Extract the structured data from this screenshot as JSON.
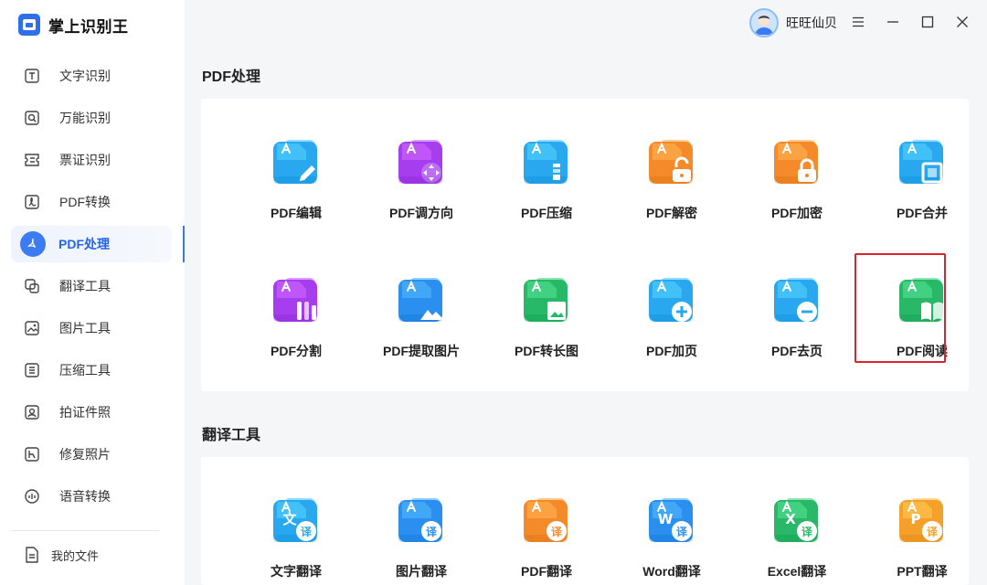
{
  "app": {
    "title": "掌上识别王"
  },
  "user": {
    "name": "旺旺仙贝"
  },
  "sidebar": {
    "items": [
      {
        "label": "文字识别",
        "icon": "text-recognition-icon"
      },
      {
        "label": "万能识别",
        "icon": "universal-recognition-icon"
      },
      {
        "label": "票证识别",
        "icon": "ticket-recognition-icon"
      },
      {
        "label": "PDF转换",
        "icon": "pdf-convert-icon"
      },
      {
        "label": "PDF处理",
        "icon": "pdf-process-icon",
        "active": true
      },
      {
        "label": "翻译工具",
        "icon": "translate-tool-icon"
      },
      {
        "label": "图片工具",
        "icon": "image-tool-icon"
      },
      {
        "label": "压缩工具",
        "icon": "compress-tool-icon"
      },
      {
        "label": "拍证件照",
        "icon": "id-photo-icon"
      },
      {
        "label": "修复照片",
        "icon": "repair-photo-icon"
      },
      {
        "label": "语音转换",
        "icon": "voice-convert-icon"
      }
    ],
    "my_files": "我的文件"
  },
  "pdf_section": {
    "title": "PDF处理",
    "tools": [
      {
        "label": "PDF编辑",
        "icon": "pdf-edit-icon",
        "color": "#29a8f0",
        "glyph": "pencil"
      },
      {
        "label": "PDF调方向",
        "icon": "pdf-rotate-icon",
        "color": "#a63ef0",
        "glyph": "arrows"
      },
      {
        "label": "PDF压缩",
        "icon": "pdf-compress-icon",
        "color": "#29a8f0",
        "glyph": "zip"
      },
      {
        "label": "PDF解密",
        "icon": "pdf-decrypt-icon",
        "color": "#f58a2a",
        "glyph": "unlock"
      },
      {
        "label": "PDF加密",
        "icon": "pdf-encrypt-icon",
        "color": "#f58a2a",
        "glyph": "lock"
      },
      {
        "label": "PDF合并",
        "icon": "pdf-merge-icon",
        "color": "#29a8f0",
        "glyph": "merge"
      },
      {
        "label": "PDF分割",
        "icon": "pdf-split-icon",
        "color": "#a63ef0",
        "glyph": "split"
      },
      {
        "label": "PDF提取图片",
        "icon": "pdf-extract-image-icon",
        "color": "#2b8ff0",
        "glyph": "mountain"
      },
      {
        "label": "PDF转长图",
        "icon": "pdf-long-image-icon",
        "color": "#28b868",
        "glyph": "picture"
      },
      {
        "label": "PDF加页",
        "icon": "pdf-add-page-icon",
        "color": "#29a8f0",
        "glyph": "plus"
      },
      {
        "label": "PDF去页",
        "icon": "pdf-remove-page-icon",
        "color": "#29a8f0",
        "glyph": "minus"
      },
      {
        "label": "PDF阅读",
        "icon": "pdf-read-icon",
        "color": "#28b868",
        "glyph": "book"
      }
    ]
  },
  "translate_section": {
    "title": "翻译工具",
    "tools": [
      {
        "label": "文字翻译",
        "icon": "text-translate-icon",
        "color": "#29a8f0",
        "letter": "文"
      },
      {
        "label": "图片翻译",
        "icon": "image-translate-icon",
        "color": "#2b8ff0",
        "letter": ""
      },
      {
        "label": "PDF翻译",
        "icon": "pdf-translate-icon",
        "color": "#f58a2a",
        "letter": ""
      },
      {
        "label": "Word翻译",
        "icon": "word-translate-icon",
        "color": "#2b8ff0",
        "letter": "W"
      },
      {
        "label": "Excel翻译",
        "icon": "excel-translate-icon",
        "color": "#28b868",
        "letter": "X"
      },
      {
        "label": "PPT翻译",
        "icon": "ppt-translate-icon",
        "color": "#f5a02a",
        "letter": "P"
      }
    ],
    "badge": "译"
  }
}
